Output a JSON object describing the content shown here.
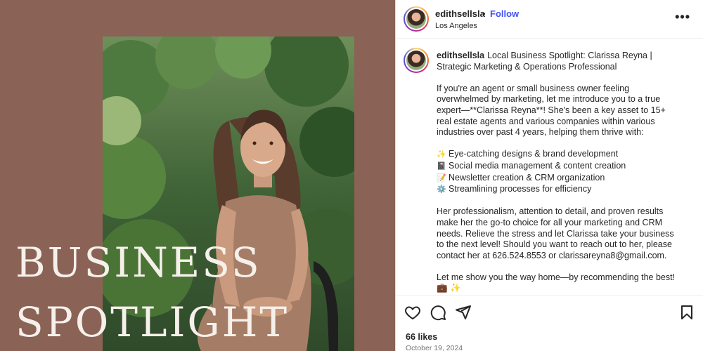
{
  "media": {
    "overlay_line1": "BUSINESS",
    "overlay_line2": "SPOTLIGHT"
  },
  "header": {
    "username": "edithsellsla",
    "separator": "•",
    "follow_label": "Follow",
    "location": "Los Angeles",
    "more_icon": "more-horizontal-icon"
  },
  "caption": {
    "username": "edithsellsla",
    "headline": "Local Business Spotlight: Clarissa Reyna | Strategic Marketing & Operations Professional",
    "intro": "If you're an agent or small business owner feeling overwhelmed by marketing, let me introduce you to a true expert—**Clarissa Reyna**! She's been a key asset to 15+ real estate agents and various companies within various industries over past 4 years, helping them thrive with:",
    "services": [
      {
        "emoji": "✨",
        "text": "Eye-catching designs & brand development"
      },
      {
        "emoji": "📓",
        "text": "Social media management & content creation"
      },
      {
        "emoji": "📝",
        "text": "Newsletter creation & CRM organization"
      },
      {
        "emoji": "⚙️",
        "text": "Streamlining processes for efficiency"
      }
    ],
    "closing": "Her professionalism, attention to detail, and proven results make her the go-to choice for all your marketing and CRM needs. Relieve the stress and let Clarissa take your business to the next level! Should you want to reach out to her, please contact her at 626.524.8553 or clarissareyna8@gmail.com.",
    "signoff": "Let me show you the way home—by recommending the best! 💼 ✨"
  },
  "actions": {
    "icons": [
      "heart-icon",
      "comment-icon",
      "share-icon",
      "bookmark-icon"
    ],
    "likes": "66 likes",
    "date": "October 19, 2024"
  }
}
